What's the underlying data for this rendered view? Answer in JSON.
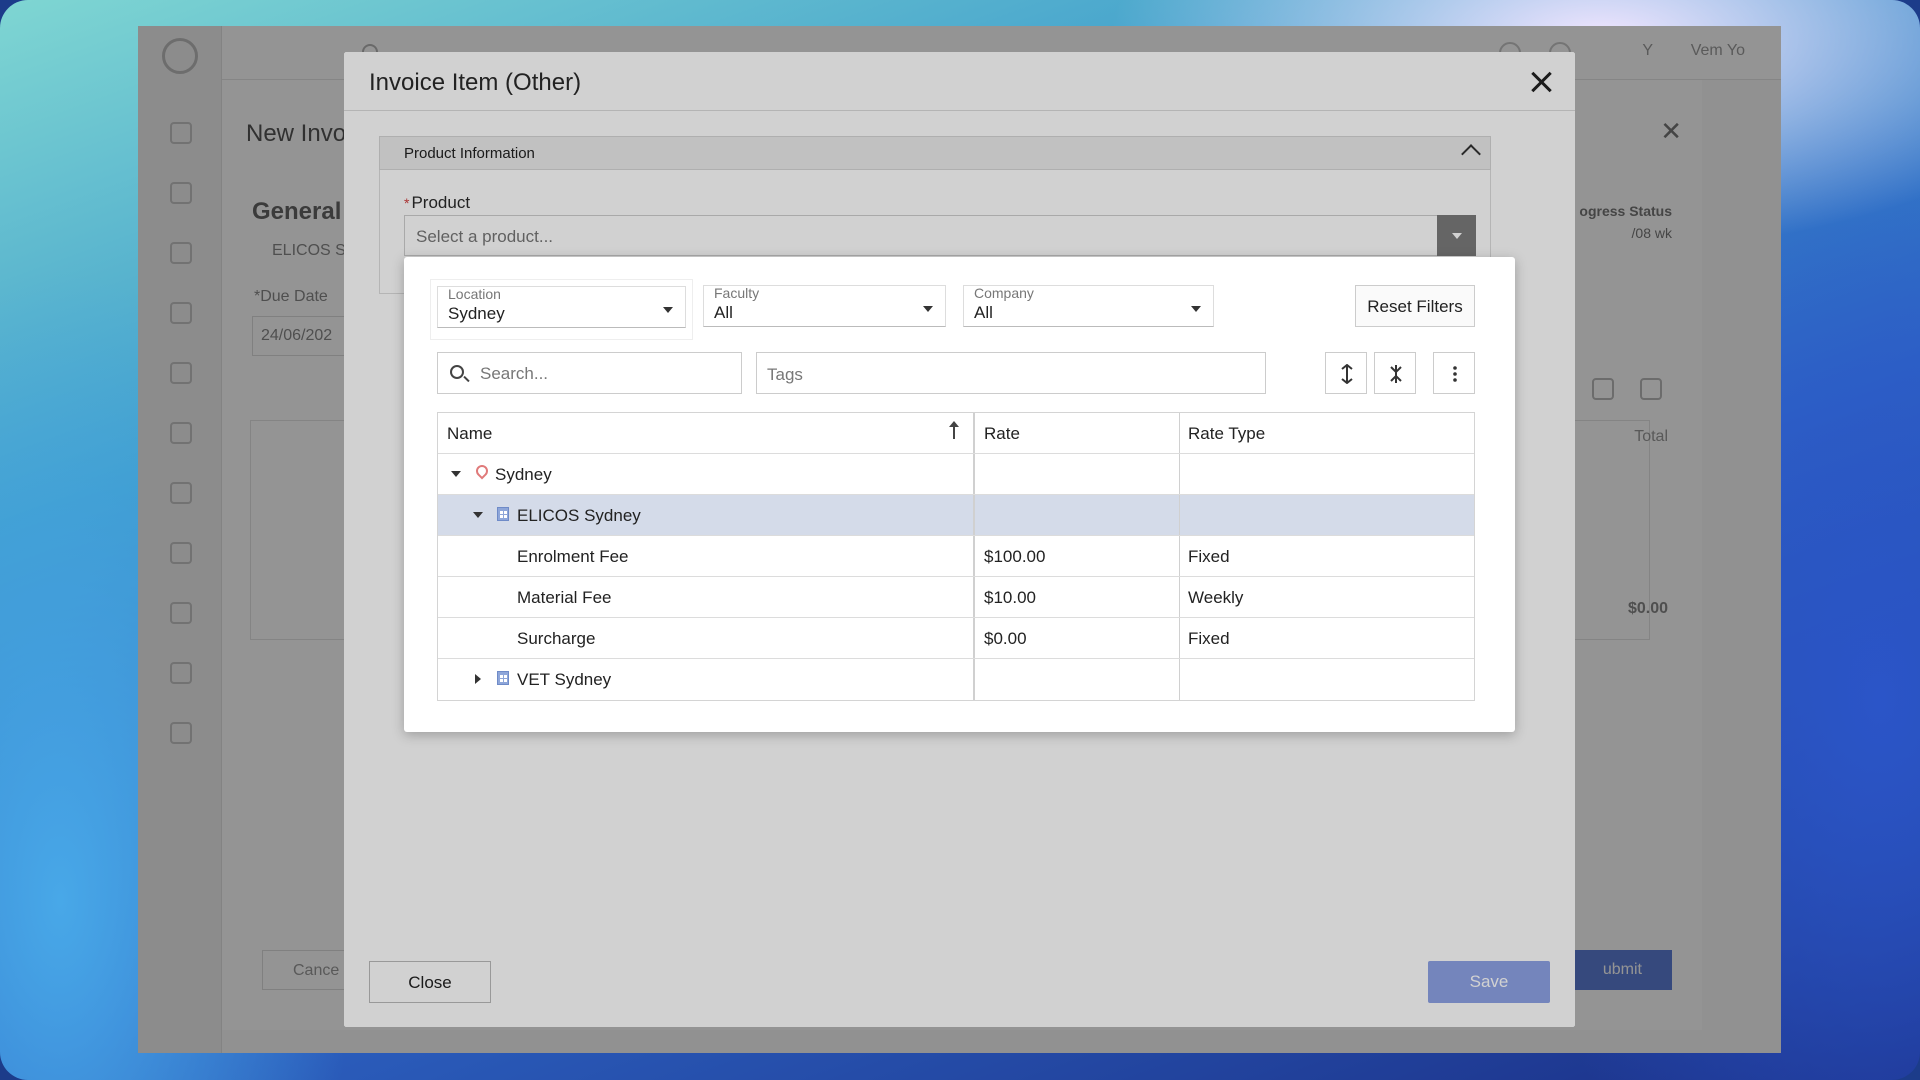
{
  "background_app": {
    "title": "New Invo",
    "section": "General",
    "sub": "ELICOS S",
    "due_label": "*Due Date",
    "due_value": "24/06/202",
    "progress_label": "ogress Status",
    "progress_value": "/08 wk",
    "total_label": "Total",
    "total_amount": "$0.00",
    "cancel_label": "Cance",
    "submit_label": "ubmit",
    "user_initials": "Y",
    "user_name": "Vem Yo"
  },
  "modal": {
    "title": "Invoice Item (Other)",
    "section_title": "Product Information",
    "product_label": "Product",
    "product_placeholder": "Select a product...",
    "close_label": "Close",
    "save_label": "Save"
  },
  "filters": {
    "location": {
      "label": "Location",
      "value": "Sydney"
    },
    "faculty": {
      "label": "Faculty",
      "value": "All"
    },
    "company": {
      "label": "Company",
      "value": "All"
    },
    "reset_label": "Reset Filters",
    "search_placeholder": "Search...",
    "tags_placeholder": "Tags"
  },
  "grid": {
    "columns": [
      "Name",
      "Rate",
      "Rate Type"
    ],
    "rows": [
      {
        "name": "Sydney",
        "rate": "",
        "type": "",
        "level": 0,
        "expanded": true,
        "icon": "location-pin-icon"
      },
      {
        "name": "ELICOS Sydney",
        "rate": "",
        "type": "",
        "level": 1,
        "expanded": true,
        "icon": "building-icon",
        "selected": true
      },
      {
        "name": "Enrolment Fee",
        "rate": "$100.00",
        "type": "Fixed",
        "level": 2
      },
      {
        "name": "Material Fee",
        "rate": "$10.00",
        "type": "Weekly",
        "level": 2
      },
      {
        "name": "Surcharge",
        "rate": "$0.00",
        "type": "Fixed",
        "level": 2
      },
      {
        "name": "VET Sydney",
        "rate": "",
        "type": "",
        "level": 1,
        "expanded": false,
        "icon": "building-icon"
      }
    ]
  },
  "colors": {
    "accent": "#8ea3e6",
    "selected_row": "#d4dbe9",
    "pin": "#e07a7a",
    "building": "#8ea6d9"
  }
}
